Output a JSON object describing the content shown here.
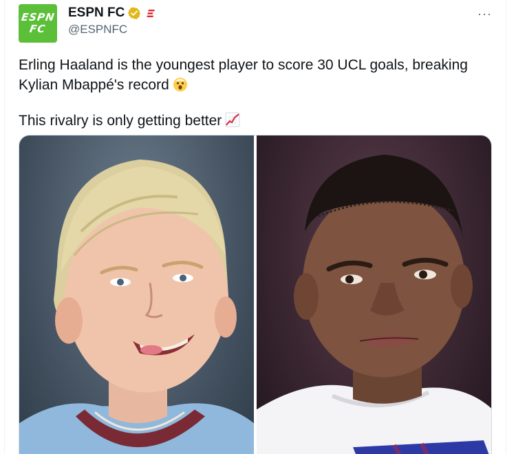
{
  "tweet": {
    "author": {
      "display_name": "ESPN FC",
      "handle": "@ESPNFC",
      "avatar_text": [
        "ESPN",
        "FC"
      ],
      "verified_icon": "verified-badge-icon",
      "affiliation_icon": "espn-affiliate-icon"
    },
    "more_label": "···",
    "text_paragraph_1": "Erling Haaland is the youngest player to score 30 UCL goals, breaking Kylian Mbappé's record",
    "text_paragraph_2": "This rivalry is only getting better",
    "emoji_1": "shocked-face-emoji-icon",
    "emoji_2": "chart-increasing-emoji-icon",
    "media": {
      "left_photo": "Erling Haaland portrait",
      "right_photo": "Kylian Mbappé portrait"
    },
    "colors": {
      "brand": "#5cbf3a",
      "verified": "#e2b719",
      "text": "#0f1419",
      "secondary": "#536471"
    }
  }
}
